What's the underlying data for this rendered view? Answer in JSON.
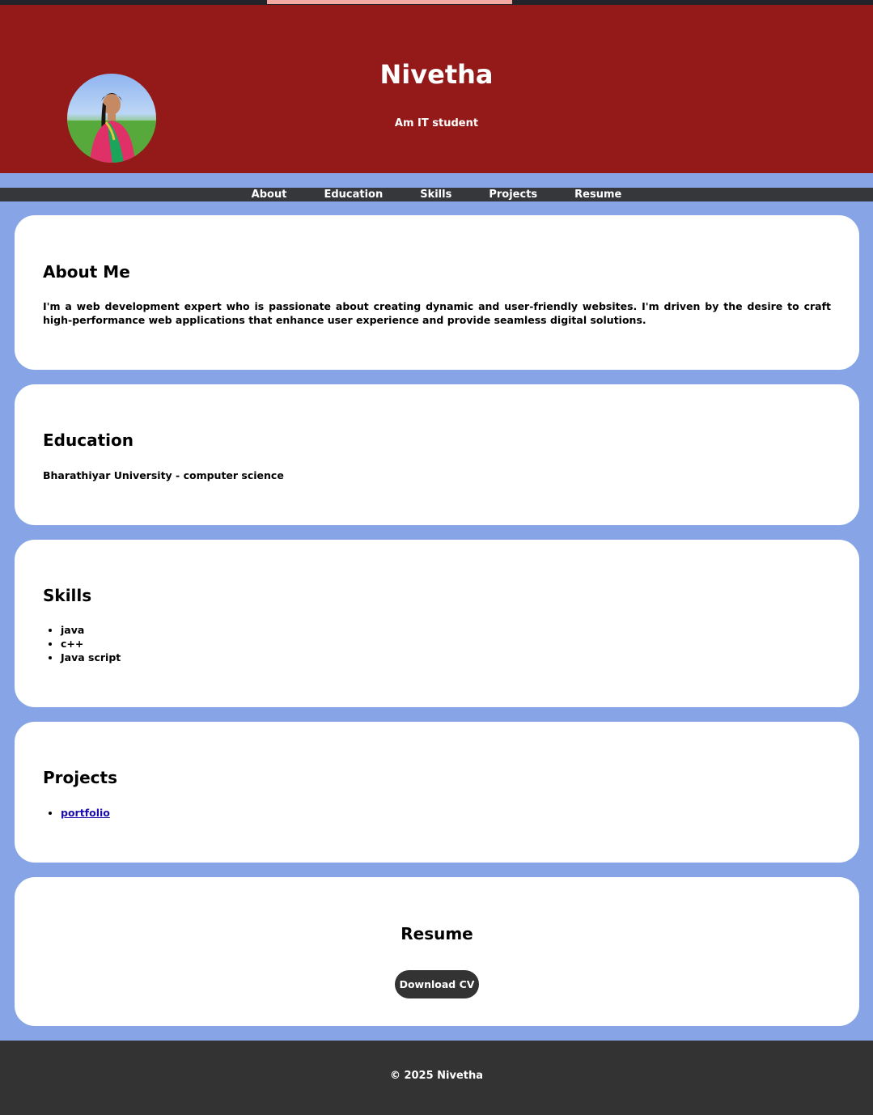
{
  "colors": {
    "header_bg": "#941a1a",
    "page_bg": "#87a5e6",
    "nav_bg": "#36373b",
    "footer_bg": "#333333",
    "button_bg": "#333333",
    "accent_strip": "#f4aaa2"
  },
  "header": {
    "title": "Nivetha",
    "subtitle": "Am IT student",
    "avatar_icon": "profile-photo"
  },
  "nav": {
    "items": [
      "About",
      "Education",
      "Skills",
      "Projects",
      "Resume"
    ]
  },
  "about": {
    "heading": "About Me",
    "text": "I'm a web development expert who is passionate about creating dynamic and user-friendly websites. I'm driven by the desire to craft high-performance web applications that enhance user experience and provide seamless digital solutions."
  },
  "education": {
    "heading": "Education",
    "text": "Bharathiyar University - computer science"
  },
  "skills": {
    "heading": "Skills",
    "items": [
      "java",
      "c++",
      "Java script"
    ]
  },
  "projects": {
    "heading": "Projects",
    "items": [
      "portfolio"
    ]
  },
  "resume": {
    "heading": "Resume",
    "button_label": "Download CV"
  },
  "footer": {
    "text": "© 2025 Nivetha"
  }
}
